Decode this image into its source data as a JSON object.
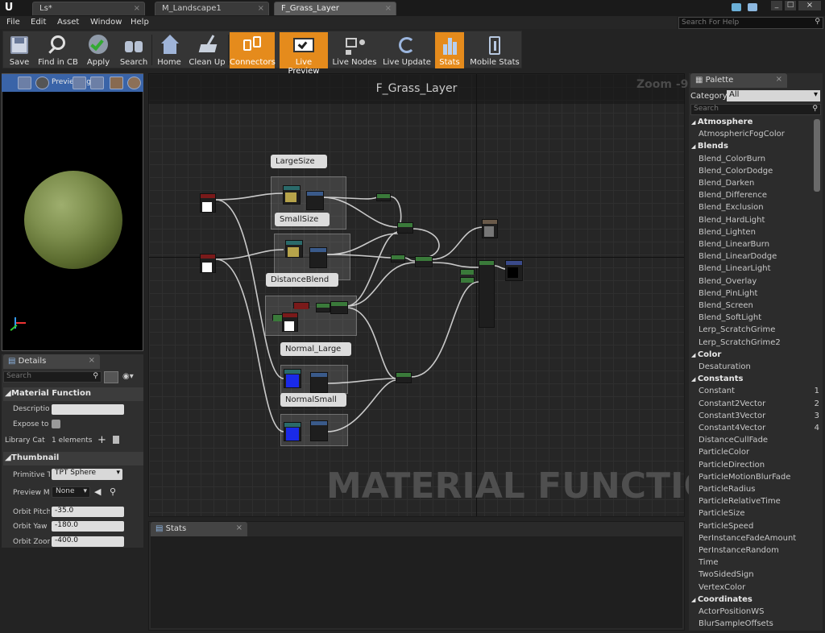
{
  "tabs": [
    {
      "label": "Ls*"
    },
    {
      "label": "M_Landscape1"
    },
    {
      "label": "F_Grass_Layer"
    }
  ],
  "menu": [
    "File",
    "Edit",
    "Asset",
    "Window",
    "Help"
  ],
  "search_help_placeholder": "Search For Help",
  "toolbar": [
    {
      "label": "Save",
      "icon": "save-icon",
      "active": false
    },
    {
      "label": "Find in CB",
      "icon": "find-in-cb-icon",
      "active": false
    },
    {
      "label": "Apply",
      "icon": "apply-check-icon",
      "active": false
    },
    {
      "label": "Search",
      "icon": "binoculars-icon",
      "active": false
    },
    {
      "label": "Home",
      "icon": "home-icon",
      "active": false
    },
    {
      "label": "Clean Up",
      "icon": "broom-icon",
      "active": false
    },
    {
      "label": "Connectors",
      "icon": "connectors-icon",
      "active": true
    },
    {
      "label": "Live Preview",
      "icon": "live-preview-icon",
      "active": true
    },
    {
      "label": "Live Nodes",
      "icon": "live-nodes-icon",
      "active": false
    },
    {
      "label": "Live Update",
      "icon": "live-update-icon",
      "active": false
    },
    {
      "label": "Stats",
      "icon": "stats-icon",
      "active": true
    },
    {
      "label": "Mobile Stats",
      "icon": "mobile-stats-icon",
      "active": false
    }
  ],
  "preview": {
    "label": "Previewing"
  },
  "details": {
    "tab": "Details",
    "search_placeholder": "Search",
    "section_material": "Material Function",
    "description_label": "Description",
    "expose_label": "Expose to",
    "library_label": "Library Cat",
    "library_value": "1 elements",
    "section_thumbnail": "Thumbnail",
    "primitive_label": "Primitive T",
    "primitive_value": "TPT Sphere",
    "preview_label": "Preview M",
    "preview_value": "None",
    "pitch_label": "Orbit Pitch",
    "pitch_value": "-35.0",
    "yaw_label": "Orbit Yaw",
    "yaw_value": "-180.0",
    "zoom_label": "Orbit Zoom",
    "zoom_value": "-400.0"
  },
  "graph": {
    "title": "F_Grass_Layer",
    "zoom": "Zoom -9",
    "watermark": "MATERIAL FUNCTION",
    "comments": [
      "LargeSize",
      "SmallSize",
      "DistanceBlend",
      "Normal_Large",
      "NormalSmall"
    ]
  },
  "stats": {
    "tab": "Stats"
  },
  "palette": {
    "tab": "Palette",
    "category_label": "Category:",
    "category_value": "All",
    "search_placeholder": "Search",
    "items": [
      {
        "t": "Atmosphere",
        "cat": true
      },
      {
        "t": "AtmosphericFogColor"
      },
      {
        "t": "Blends",
        "cat": true
      },
      {
        "t": "Blend_ColorBurn"
      },
      {
        "t": "Blend_ColorDodge"
      },
      {
        "t": "Blend_Darken"
      },
      {
        "t": "Blend_Difference"
      },
      {
        "t": "Blend_Exclusion"
      },
      {
        "t": "Blend_HardLight"
      },
      {
        "t": "Blend_Lighten"
      },
      {
        "t": "Blend_LinearBurn"
      },
      {
        "t": "Blend_LinearDodge"
      },
      {
        "t": "Blend_LinearLight"
      },
      {
        "t": "Blend_Overlay"
      },
      {
        "t": "Blend_PinLight"
      },
      {
        "t": "Blend_Screen"
      },
      {
        "t": "Blend_SoftLight"
      },
      {
        "t": "Lerp_ScratchGrime"
      },
      {
        "t": "Lerp_ScratchGrime2"
      },
      {
        "t": "Color",
        "cat": true
      },
      {
        "t": "Desaturation"
      },
      {
        "t": "Constants",
        "cat": true
      },
      {
        "t": "Constant",
        "n": "1"
      },
      {
        "t": "Constant2Vector",
        "n": "2"
      },
      {
        "t": "Constant3Vector",
        "n": "3"
      },
      {
        "t": "Constant4Vector",
        "n": "4"
      },
      {
        "t": "DistanceCullFade"
      },
      {
        "t": "ParticleColor"
      },
      {
        "t": "ParticleDirection"
      },
      {
        "t": "ParticleMotionBlurFade"
      },
      {
        "t": "ParticleRadius"
      },
      {
        "t": "ParticleRelativeTime"
      },
      {
        "t": "ParticleSize"
      },
      {
        "t": "ParticleSpeed"
      },
      {
        "t": "PerInstanceFadeAmount"
      },
      {
        "t": "PerInstanceRandom"
      },
      {
        "t": "Time"
      },
      {
        "t": "TwoSidedSign"
      },
      {
        "t": "VertexColor"
      },
      {
        "t": "Coordinates",
        "cat": true
      },
      {
        "t": "ActorPositionWS"
      },
      {
        "t": "BlurSampleOffsets"
      }
    ]
  },
  "colors": {
    "accent": "#e58b1c",
    "graph_bg": "#262626"
  }
}
